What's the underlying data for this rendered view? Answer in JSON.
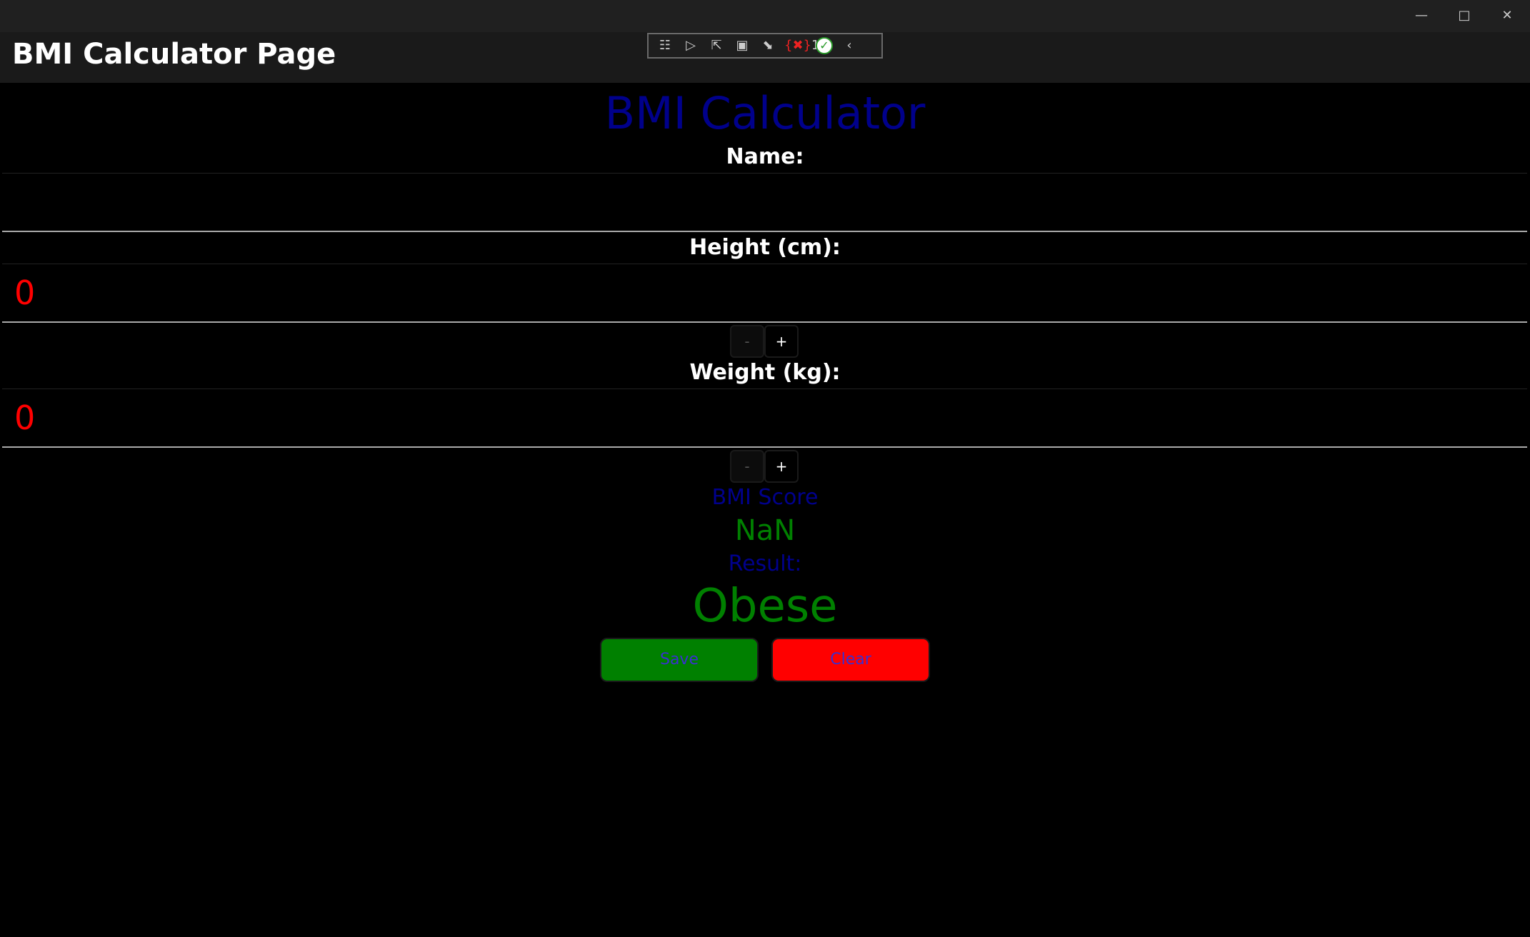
{
  "window": {
    "controls": [
      "minimize",
      "maximize",
      "close"
    ]
  },
  "header": {
    "title": "BMI Calculator Page"
  },
  "toolbar": {
    "icons": [
      "live-visual-tree-icon",
      "video-icon",
      "select-element-icon",
      "display-layout-adorners-icon",
      "track-focus-icon",
      "binding-errors-icon",
      "hot-reload-ok-icon",
      "collapse-chevron-icon"
    ],
    "binding_error_count": "1"
  },
  "main": {
    "heading": "BMI Calculator",
    "name_label": "Name:",
    "name_value": "",
    "height_label": "Height (cm):",
    "height_value": "0",
    "weight_label": "Weight (kg):",
    "weight_value": "0",
    "stepper_minus": "-",
    "stepper_plus": "+",
    "score_label": "BMI Score",
    "score_value": "NaN",
    "result_label": "Result:",
    "result_value": "Obese",
    "save_label": "Save",
    "clear_label": "Clear"
  },
  "colors": {
    "heading": "#00008b",
    "value": "#008000",
    "entry_text": "#ff0000",
    "save_bg": "#008000",
    "clear_bg": "#ff0000"
  }
}
